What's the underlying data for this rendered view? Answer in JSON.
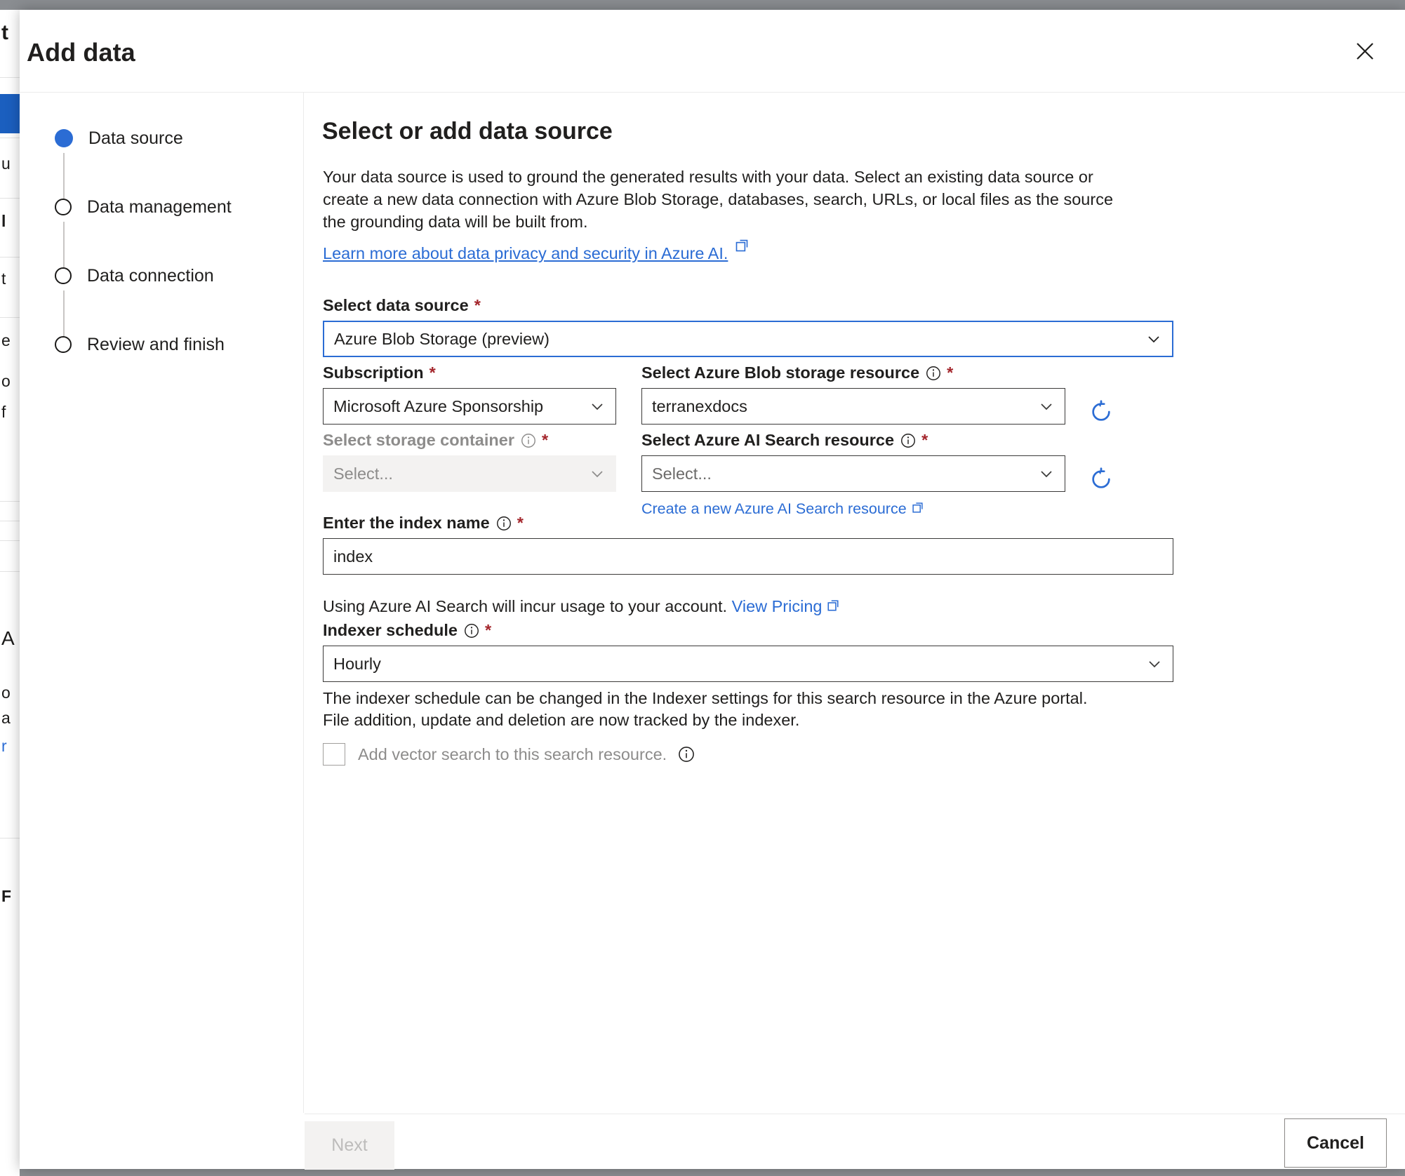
{
  "dialog": {
    "title": "Add data",
    "close_icon": "close-icon"
  },
  "stepper": {
    "steps": [
      {
        "label": "Data source",
        "state": "active"
      },
      {
        "label": "Data management",
        "state": "pending"
      },
      {
        "label": "Data connection",
        "state": "pending"
      },
      {
        "label": "Review and finish",
        "state": "pending"
      }
    ]
  },
  "main": {
    "title": "Select or add data source",
    "description": "Your data source is used to ground the generated results with your data. Select an existing data source or create a new data connection with Azure Blob Storage, databases, search, URLs, or local files as the source the grounding data will be built from.",
    "learn_more_link": "Learn more about data privacy and security in Azure AI.",
    "fields": {
      "data_source": {
        "label": "Select data source",
        "required": "*",
        "value": "Azure Blob Storage (preview)",
        "focused": true
      },
      "subscription": {
        "label": "Subscription",
        "required": "*",
        "value": "Microsoft Azure Sponsorship"
      },
      "blob_storage_resource": {
        "label": "Select Azure Blob storage resource",
        "required": "*",
        "value": "terranexdocs"
      },
      "storage_container": {
        "label": "Select storage container",
        "required": "*",
        "placeholder": "Select...",
        "disabled": true
      },
      "ai_search_resource": {
        "label": "Select Azure AI Search resource",
        "required": "*",
        "placeholder": "Select...",
        "create_link": "Create a new Azure AI Search resource"
      },
      "index_name": {
        "label": "Enter the index name",
        "required": "*",
        "value": "index"
      },
      "indexer_schedule": {
        "label": "Indexer schedule",
        "required": "*",
        "value": "Hourly"
      },
      "vector_search": {
        "label": "Add vector search to this search resource.",
        "checked": false
      }
    },
    "pricing_note_prefix": "Using Azure AI Search will incur usage to your account.",
    "pricing_link": "View Pricing",
    "indexer_note_line1": "The indexer schedule can be changed in the Indexer settings for this search resource in the Azure portal.",
    "indexer_note_line2": "File addition, update and deletion are now tracked by the indexer."
  },
  "footer": {
    "next_label": "Next",
    "cancel_label": "Cancel"
  },
  "background": {
    "fragments": [
      "t",
      "u",
      "l",
      "t",
      "e",
      "o",
      "f",
      "A",
      "o",
      "a",
      "r",
      "F"
    ]
  },
  "colors": {
    "accent": "#2b6cd4",
    "required": "#a4262c",
    "text": "#201f1e",
    "disabled_text": "#8d8c8b",
    "disabled_bg": "#f3f2f1",
    "border": "#3b3a39",
    "overlay": "#8a8d91"
  }
}
